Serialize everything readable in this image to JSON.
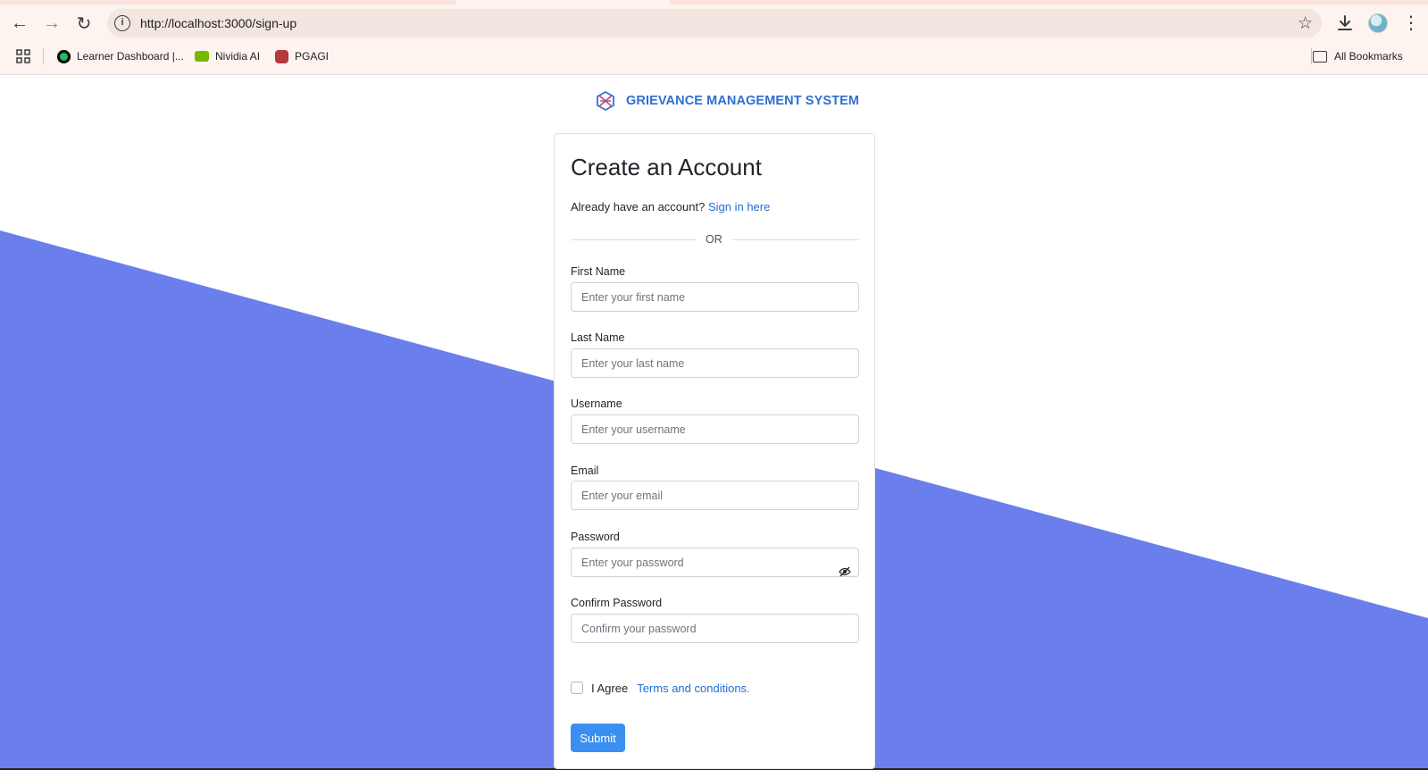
{
  "browser": {
    "url": "http://localhost:3000/sign-up",
    "bookmarks": [
      {
        "label": "Learner Dashboard |..."
      },
      {
        "label": "Nividia AI"
      },
      {
        "label": "PGAGI"
      }
    ],
    "all_bookmarks_label": "All Bookmarks"
  },
  "brand": {
    "name": "GRIEVANCE MANAGEMENT SYSTEM"
  },
  "form": {
    "title": "Create an Account",
    "signin_prompt": "Already have an account?",
    "signin_link": "Sign in here",
    "divider": "OR",
    "fields": {
      "first_name": {
        "label": "First Name",
        "placeholder": "Enter your first name"
      },
      "last_name": {
        "label": "Last Name",
        "placeholder": "Enter your last name"
      },
      "username": {
        "label": "Username",
        "placeholder": "Enter your username"
      },
      "email": {
        "label": "Email",
        "placeholder": "Enter your email"
      },
      "password": {
        "label": "Password",
        "placeholder": "Enter your password"
      },
      "confirm_password": {
        "label": "Confirm Password",
        "placeholder": "Confirm your password"
      }
    },
    "agree_label": "I Agree",
    "terms_link": "Terms and conditions.",
    "submit_label": "Submit"
  },
  "colors": {
    "background_shape": "#6a7feb",
    "brand_text": "#2f6fd1",
    "link": "#1f6fd1",
    "submit_button": "#3b8ff0"
  }
}
